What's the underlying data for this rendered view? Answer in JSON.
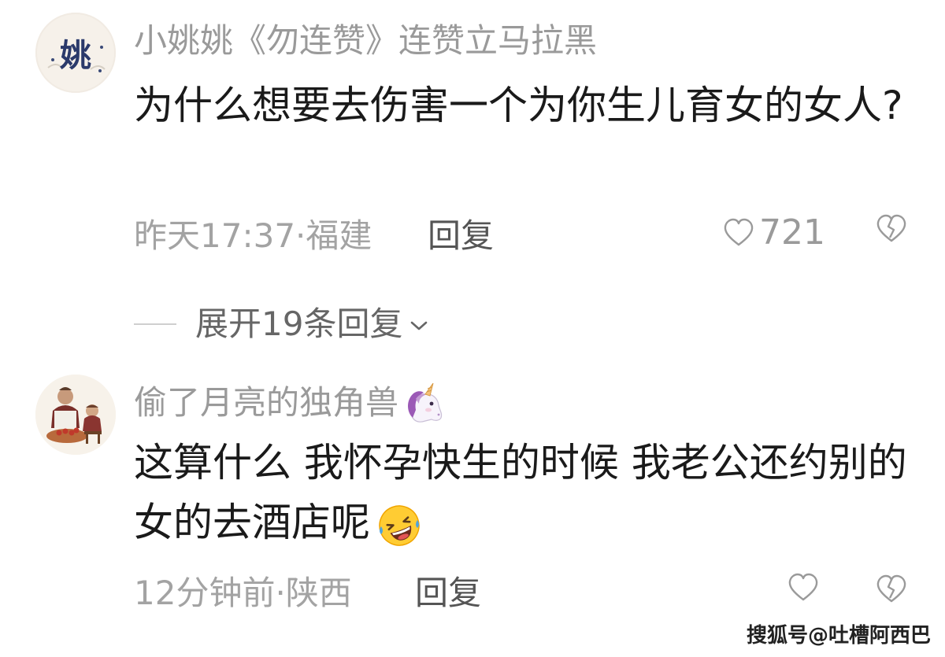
{
  "comments": [
    {
      "username": "小姚姚《勿连赞》连赞立马拉黑",
      "content": "为什么想要去伤害一个为你生儿育女的女人?",
      "meta": "昨天17:37·福建",
      "reply_label": "回复",
      "likes": "721",
      "avatar_text": "姚"
    },
    {
      "username": "偷了月亮的独角兽",
      "content": "这算什么 我怀孕快生的时候 我老公还约别的女的去酒店呢",
      "meta": "12分钟前·陕西",
      "reply_label": "回复",
      "likes": ""
    }
  ],
  "expand_replies": {
    "label": "展开19条回复"
  },
  "watermark": "搜狐号@吐槽阿西巴",
  "icons": {
    "like": "heart-outline-icon",
    "dislike": "broken-heart-icon",
    "expand": "chevron-down-icon",
    "username_emoji": "unicorn-icon",
    "content_emoji": "rolling-on-floor-laughing-icon"
  },
  "colors": {
    "text_primary": "#1a1a1a",
    "text_muted": "#a3a3a3",
    "reply_button": "#555555",
    "expand_text": "#666666"
  }
}
